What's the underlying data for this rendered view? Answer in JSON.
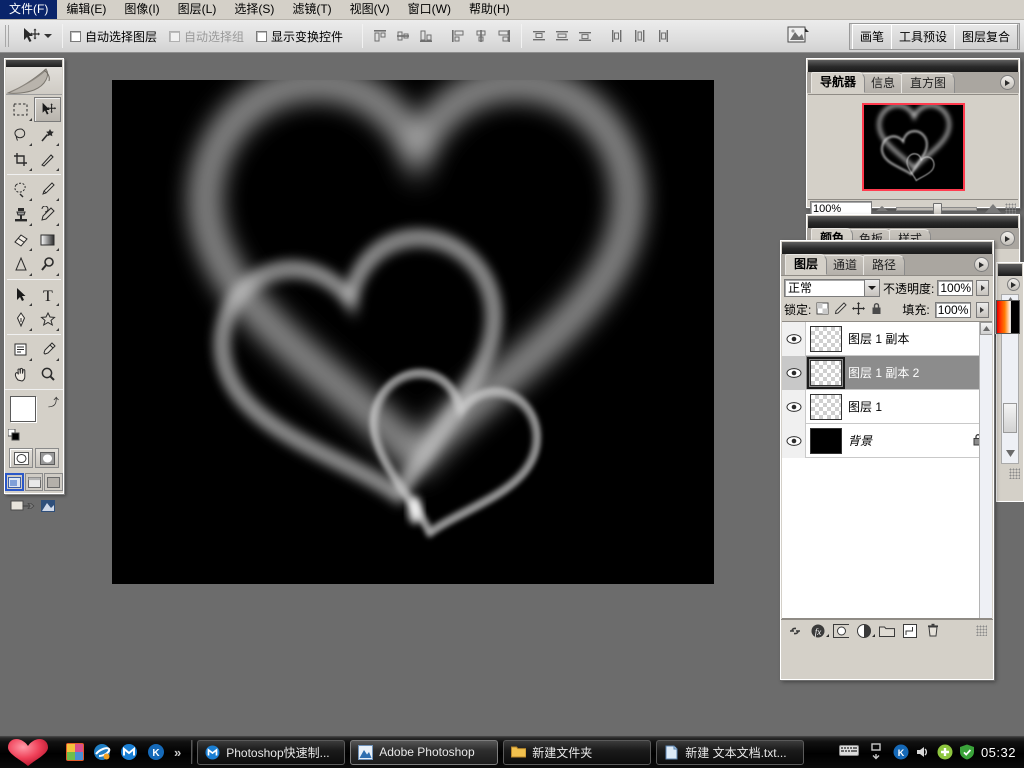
{
  "menubar": {
    "items": [
      {
        "label": "文件(F)",
        "name": "menu-file"
      },
      {
        "label": "编辑(E)",
        "name": "menu-edit"
      },
      {
        "label": "图像(I)",
        "name": "menu-image"
      },
      {
        "label": "图层(L)",
        "name": "menu-layer"
      },
      {
        "label": "选择(S)",
        "name": "menu-select"
      },
      {
        "label": "滤镜(T)",
        "name": "menu-filter"
      },
      {
        "label": "视图(V)",
        "name": "menu-view"
      },
      {
        "label": "窗口(W)",
        "name": "menu-window"
      },
      {
        "label": "帮助(H)",
        "name": "menu-help"
      }
    ]
  },
  "options_bar": {
    "tool": "move-tool",
    "checkboxes": [
      {
        "label": "自动选择图层",
        "checked": false,
        "enabled": true
      },
      {
        "label": "自动选择组",
        "checked": false,
        "enabled": false
      },
      {
        "label": "显示变换控件",
        "checked": false,
        "enabled": true
      }
    ],
    "align_buttons": [
      "align-top-edges",
      "align-vertical-centers",
      "align-bottom-edges",
      "align-left-edges",
      "align-horizontal-centers",
      "align-right-edges"
    ],
    "distribute_buttons": [
      "distribute-top-edges",
      "distribute-vertical-centers",
      "distribute-bottom-edges",
      "distribute-left-edges",
      "distribute-horizontal-centers",
      "distribute-right-edges"
    ],
    "palette_well": [
      {
        "label": "画笔",
        "name": "well-tab-brushes"
      },
      {
        "label": "工具预设",
        "name": "well-tab-tool-presets"
      },
      {
        "label": "图层复合",
        "name": "well-tab-layer-comps"
      }
    ]
  },
  "toolbox": {
    "tools": [
      {
        "name": "rectangular-marquee-tool",
        "selected": false,
        "has_flyout": true
      },
      {
        "name": "move-tool",
        "selected": true,
        "has_flyout": false
      },
      {
        "name": "lasso-tool",
        "selected": false,
        "has_flyout": true
      },
      {
        "name": "magic-wand-tool",
        "selected": false,
        "has_flyout": false
      },
      {
        "name": "crop-tool",
        "selected": false,
        "has_flyout": false
      },
      {
        "name": "slice-tool",
        "selected": false,
        "has_flyout": true
      },
      {
        "name": "healing-brush-tool",
        "selected": false,
        "has_flyout": true
      },
      {
        "name": "brush-tool",
        "selected": false,
        "has_flyout": true
      },
      {
        "name": "clone-stamp-tool",
        "selected": false,
        "has_flyout": true
      },
      {
        "name": "history-brush-tool",
        "selected": false,
        "has_flyout": true
      },
      {
        "name": "eraser-tool",
        "selected": false,
        "has_flyout": true
      },
      {
        "name": "gradient-tool",
        "selected": false,
        "has_flyout": true
      },
      {
        "name": "blur-tool",
        "selected": false,
        "has_flyout": true
      },
      {
        "name": "dodge-tool",
        "selected": false,
        "has_flyout": true
      },
      {
        "name": "path-selection-tool",
        "selected": false,
        "has_flyout": true
      },
      {
        "name": "type-tool",
        "selected": false,
        "has_flyout": true
      },
      {
        "name": "pen-tool",
        "selected": false,
        "has_flyout": true
      },
      {
        "name": "custom-shape-tool",
        "selected": false,
        "has_flyout": true
      },
      {
        "name": "notes-tool",
        "selected": false,
        "has_flyout": true
      },
      {
        "name": "eyedropper-tool",
        "selected": false,
        "has_flyout": true
      },
      {
        "name": "hand-tool",
        "selected": false,
        "has_flyout": false
      },
      {
        "name": "zoom-tool",
        "selected": false,
        "has_flyout": false
      }
    ],
    "foreground_color": "#ffffff",
    "background_color": "#000000",
    "quick_mask": "standard-mode",
    "screen_mode": "standard-screen-mode"
  },
  "navigator": {
    "tabs": [
      {
        "label": "导航器",
        "active": true,
        "name": "tab-navigator"
      },
      {
        "label": "信息",
        "active": false,
        "name": "tab-info"
      },
      {
        "label": "直方图",
        "active": false,
        "name": "tab-histogram"
      }
    ],
    "zoom_value": "100%",
    "view_box_color": "#ff3b4e"
  },
  "color_palette": {
    "tabs": [
      {
        "label": "颜色",
        "active": true,
        "name": "tab-color"
      },
      {
        "label": "色板",
        "active": false,
        "name": "tab-swatches"
      },
      {
        "label": "样式",
        "active": false,
        "name": "tab-styles"
      }
    ]
  },
  "layers_palette": {
    "tabs": [
      {
        "label": "图层",
        "active": true,
        "name": "tab-layers"
      },
      {
        "label": "通道",
        "active": false,
        "name": "tab-channels"
      },
      {
        "label": "路径",
        "active": false,
        "name": "tab-paths"
      }
    ],
    "blend_mode": "正常",
    "opacity_label": "不透明度:",
    "opacity_value": "100%",
    "lock_label": "锁定:",
    "fill_label": "填充:",
    "fill_value": "100%",
    "lock_buttons": [
      "lock-transparent-pixels",
      "lock-image-pixels",
      "lock-position",
      "lock-all"
    ],
    "layers": [
      {
        "name": "图层 1 副本",
        "visible": true,
        "selected": false,
        "thumb": "transparent",
        "locked": false
      },
      {
        "name": "图层 1 副本 2",
        "visible": true,
        "selected": true,
        "thumb": "transparent",
        "locked": false
      },
      {
        "name": "图层 1",
        "visible": true,
        "selected": false,
        "thumb": "transparent",
        "locked": false
      },
      {
        "name": "背景",
        "visible": true,
        "selected": false,
        "thumb": "black",
        "locked": true
      }
    ],
    "footer_buttons": [
      "link-layers-button",
      "add-layer-style-button",
      "add-layer-mask-button",
      "new-adjustment-layer-button",
      "new-group-button",
      "new-layer-button",
      "delete-layer-button"
    ]
  },
  "canvas": {
    "background_color": "#000000",
    "artwork": "three-glowing-hearts"
  },
  "taskbar": {
    "start_button": "heart-start-button",
    "quick_launch": [
      "show-desktop-icon",
      "ie-icon",
      "maxthon-icon",
      "kingsoft-icon"
    ],
    "overflow": "»",
    "tasks": [
      {
        "label": "Photoshop快速制...",
        "icon": "maxthon-icon",
        "active": false
      },
      {
        "label": "Adobe Photoshop",
        "icon": "photoshop-icon",
        "active": true
      },
      {
        "label": "新建文件夹",
        "icon": "folder-icon",
        "active": false
      },
      {
        "label": "新建 文本文档.txt...",
        "icon": "notepad-icon",
        "active": false
      }
    ],
    "tray_icons": [
      "keyboard-icon",
      "language-bar-icon",
      "kingsoft-icon",
      "volume-icon",
      "360-safe-icon",
      "shield-icon"
    ],
    "clock": "05:32"
  }
}
